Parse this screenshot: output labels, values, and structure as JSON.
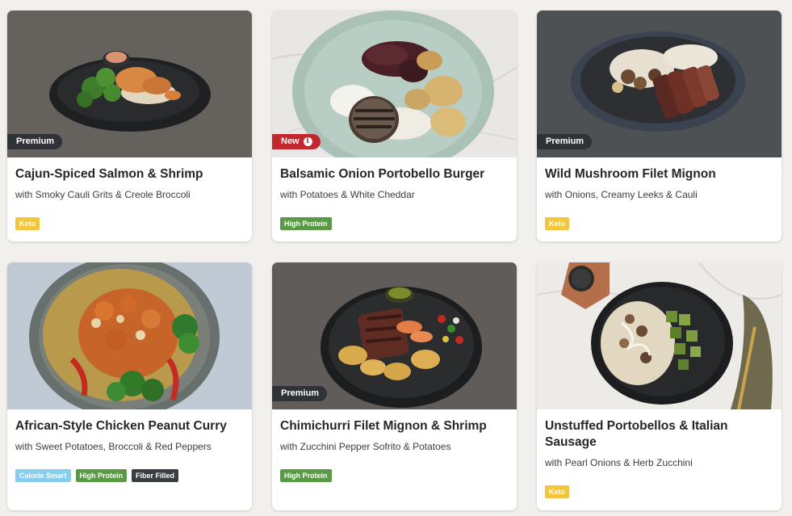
{
  "colors": {
    "page_bg": "#f1f0ec",
    "premium_badge": "#2f3236",
    "new_badge": "#c1272d",
    "keto_tag": "#f2c53d",
    "high_protein_tag": "#5a9a47",
    "calorie_smart_tag": "#87cdee",
    "fiber_filled_tag": "#3a3d42"
  },
  "meals": [
    {
      "title": "Cajun-Spiced Salmon & Shrimp",
      "subtitle": "with Smoky Cauli Grits & Creole Broccoli",
      "badge": "Premium",
      "tags": [
        "Keto"
      ]
    },
    {
      "title": "Balsamic Onion Portobello Burger",
      "subtitle": "with Potatoes & White Cheddar",
      "badge": "New",
      "badge_icon": "info-icon",
      "tags": [
        "High Protein"
      ]
    },
    {
      "title": "Wild Mushroom Filet Mignon",
      "subtitle": "with Onions, Creamy Leeks & Cauli",
      "badge": "Premium",
      "tags": [
        "Keto"
      ]
    },
    {
      "title": "African-Style Chicken Peanut Curry",
      "subtitle": "with Sweet Potatoes, Broccoli & Red Peppers",
      "tags": [
        "Calorie Smart",
        "High Protein",
        "Fiber Filled"
      ]
    },
    {
      "title": "Chimichurri Filet Mignon & Shrimp",
      "subtitle": "with Zucchini Pepper Sofrito & Potatoes",
      "badge": "Premium",
      "tags": [
        "High Protein"
      ]
    },
    {
      "title": "Unstuffed Portobellos & Italian Sausage",
      "subtitle": "with Pearl Onions & Herb Zucchini",
      "tags": [
        "Keto"
      ]
    }
  ]
}
